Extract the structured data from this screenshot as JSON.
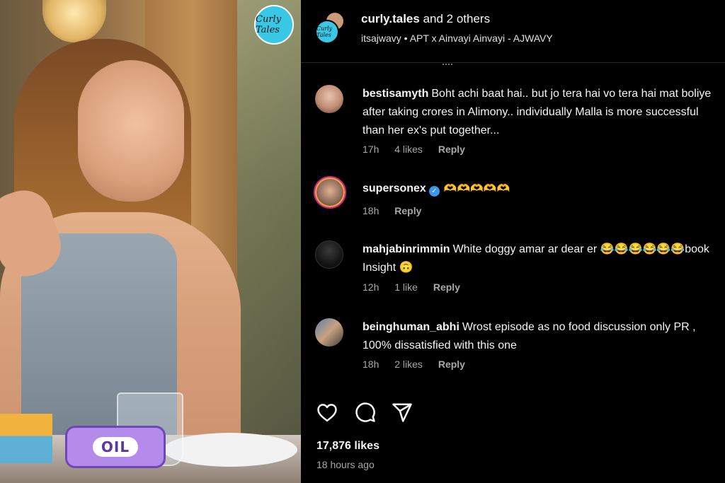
{
  "media": {
    "brand_badge": "Curly Tales",
    "sticker_label": "OIL"
  },
  "header": {
    "avatar_badge": "Curly Tales",
    "title_user": "curly.tales",
    "title_rest": "and 2 others",
    "subtitle": "itsajwavy • APT x Ainvayi Ainvayi - AJWAVY"
  },
  "comments": [
    {
      "username": "bestisamyth",
      "text": "Boht achi baat hai.. but jo tera hai vo tera hai mat boliye after taking crores in Alimony.. individually Malla is more successful than her ex's put together...",
      "time": "17h",
      "likes": "4 likes",
      "reply": "Reply"
    },
    {
      "username": "supersonex",
      "verified": true,
      "text": "🫶🫶🫶🫶🫶",
      "time": "18h",
      "likes": "",
      "reply": "Reply"
    },
    {
      "username": "mahjabinrimmin",
      "text": "White doggy amar ar dear er 😂😂😂😂😂😂book Insight 🙃",
      "time": "12h",
      "likes": "1 like",
      "reply": "Reply"
    },
    {
      "username": "beinghuman_abhi",
      "text": "Wrost episode as no food discussion only PR , 100% dissatisfied with this one",
      "time": "18h",
      "likes": "2 likes",
      "reply": "Reply"
    }
  ],
  "actions": {
    "like_icon": "heart-icon",
    "comment_icon": "comment-icon",
    "share_icon": "send-icon"
  },
  "stats": {
    "likes": "17,876 likes",
    "posted": "18 hours ago"
  }
}
